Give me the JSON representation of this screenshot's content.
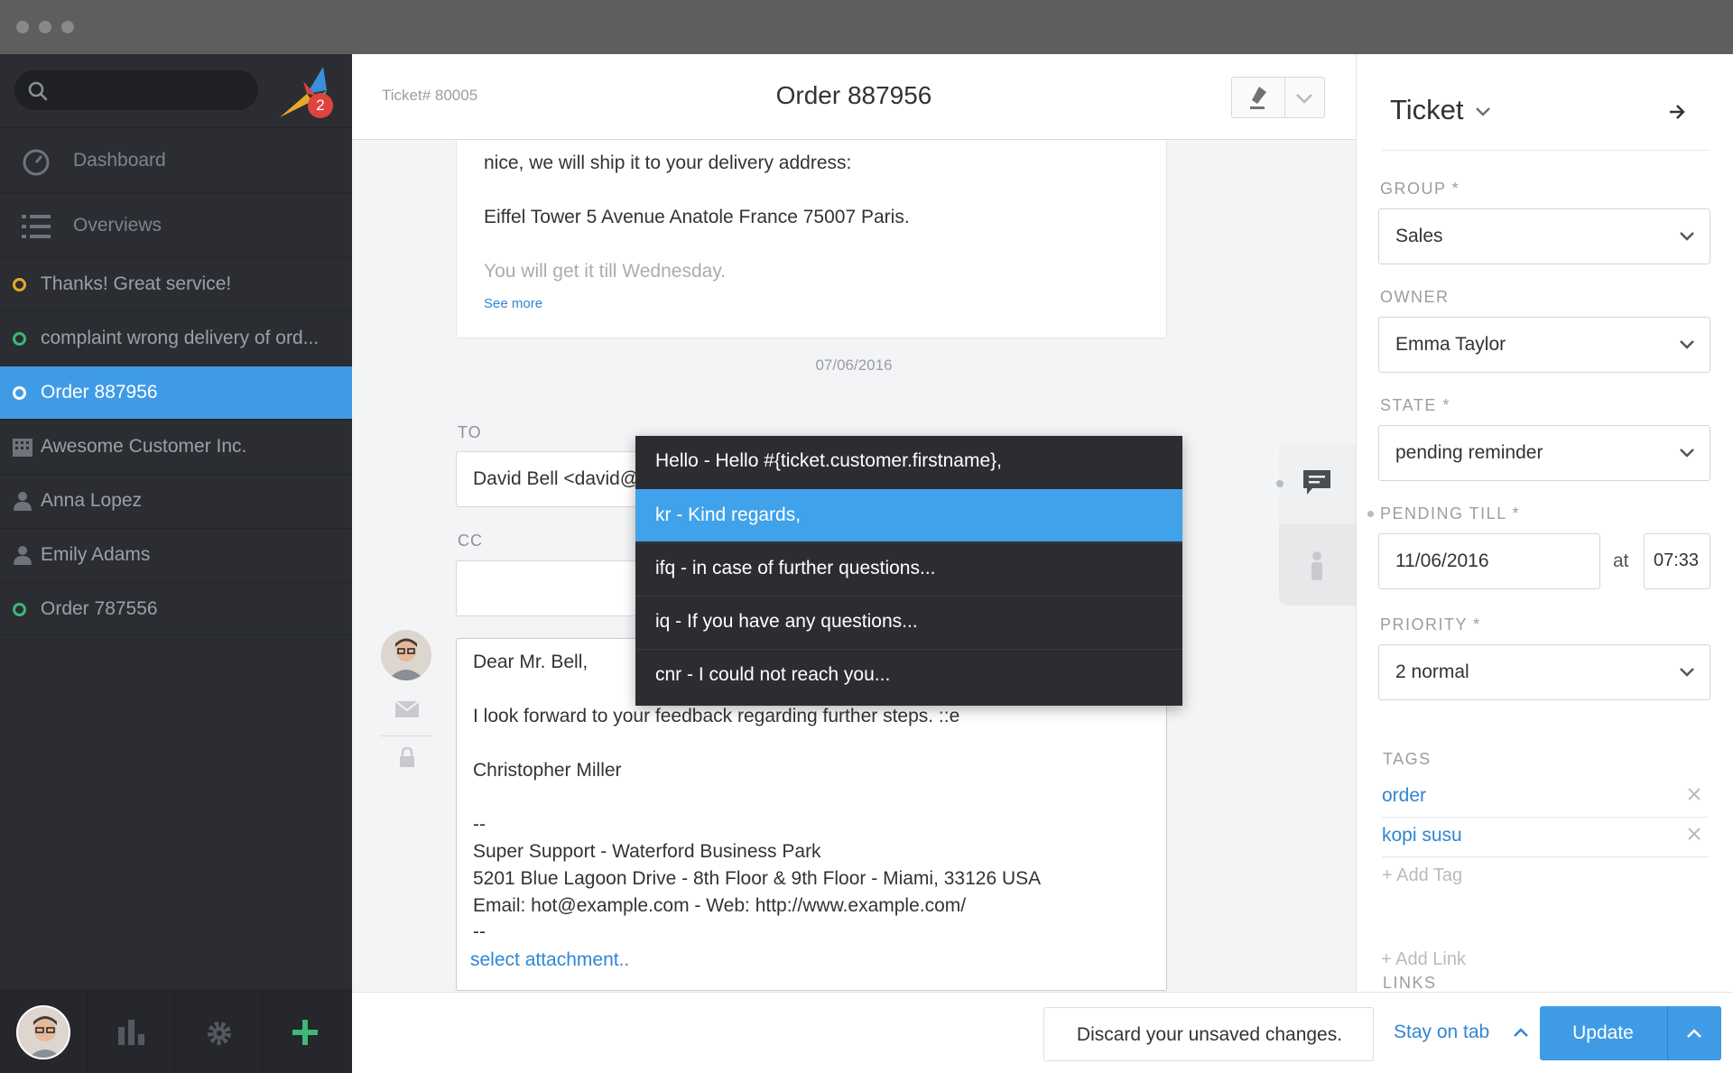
{
  "sidebar": {
    "notification_count": "2",
    "nav": [
      {
        "label": "Dashboard",
        "icon": "dashboard-icon"
      },
      {
        "label": "Overviews",
        "icon": "list-icon"
      }
    ],
    "items": [
      {
        "label": "Thanks! Great service!",
        "icon": "ticket-status-icon",
        "status_color": "#e9a82a"
      },
      {
        "label": "complaint wrong delivery of ord...",
        "icon": "ticket-status-icon",
        "status_color": "#3cb878"
      },
      {
        "label": "Order 887956",
        "icon": "ticket-status-icon",
        "status_color": "#ffffff"
      },
      {
        "label": "Awesome Customer Inc.",
        "icon": "organization-icon"
      },
      {
        "label": "Anna Lopez",
        "icon": "user-icon"
      },
      {
        "label": "Emily Adams",
        "icon": "user-icon"
      },
      {
        "label": "Order 787556",
        "icon": "ticket-status-icon",
        "status_color": "#3cb878"
      }
    ]
  },
  "header": {
    "ticket_number": "Ticket# 80005",
    "title": "Order 887956"
  },
  "article": {
    "line1": "nice, we will ship it to your delivery address:",
    "line2": "Eiffel Tower 5 Avenue Anatole France 75007 Paris.",
    "line3": "You will get it till Wednesday.",
    "see_more": "See more",
    "date": "07/06/2016"
  },
  "reply": {
    "to_label": "TO",
    "to_value": "David Bell <david@",
    "cc_label": "CC",
    "body": [
      "Dear Mr. Bell,",
      "I look forward to your feedback regarding further steps. ::e",
      "Christopher Miller",
      "--",
      "Super Support - Waterford Business Park",
      "5201 Blue Lagoon Drive - 8th Floor & 9th Floor - Miami, 33126 USA",
      "Email: hot@example.com - Web: http://www.example.com/",
      "--"
    ],
    "attachment": "select attachment.."
  },
  "textmodules": [
    "Hello - Hello #{ticket.customer.firstname},",
    "kr - Kind regards,",
    "ifq - in case of further questions...",
    "iq - If you have any questions...",
    "cnr - I could not reach you..."
  ],
  "panel": {
    "title": "Ticket",
    "group_label": "GROUP *",
    "group_value": "Sales",
    "owner_label": "OWNER",
    "owner_value": "Emma Taylor",
    "state_label": "STATE *",
    "state_value": "pending reminder",
    "pending_label": "PENDING TILL *",
    "pending_date": "11/06/2016",
    "pending_at": "at",
    "pending_time": "07:33",
    "priority_label": "PRIORITY *",
    "priority_value": "2 normal",
    "tags_label": "TAGS",
    "tags": [
      "order",
      "kopi susu"
    ],
    "add_tag": "+ Add Tag",
    "links_label": "LINKS",
    "add_link": "+ Add Link"
  },
  "bottombar": {
    "discard": "Discard your unsaved changes.",
    "stay": "Stay on tab",
    "update": "Update"
  }
}
